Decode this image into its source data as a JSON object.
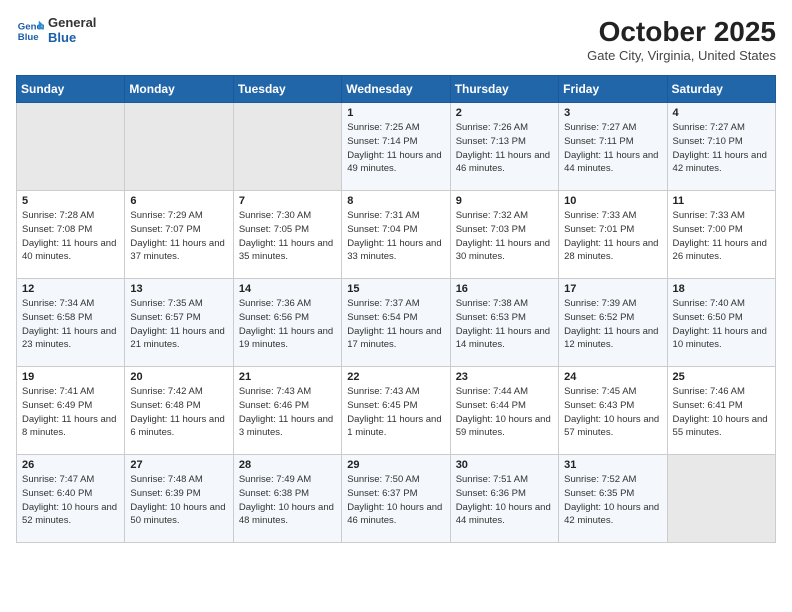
{
  "header": {
    "logo_line1": "General",
    "logo_line2": "Blue",
    "month": "October 2025",
    "location": "Gate City, Virginia, United States"
  },
  "days_of_week": [
    "Sunday",
    "Monday",
    "Tuesday",
    "Wednesday",
    "Thursday",
    "Friday",
    "Saturday"
  ],
  "weeks": [
    [
      {
        "day": "",
        "empty": true
      },
      {
        "day": "",
        "empty": true
      },
      {
        "day": "",
        "empty": true
      },
      {
        "day": "1",
        "rise": "7:25 AM",
        "set": "7:14 PM",
        "daylight": "11 hours and 49 minutes."
      },
      {
        "day": "2",
        "rise": "7:26 AM",
        "set": "7:13 PM",
        "daylight": "11 hours and 46 minutes."
      },
      {
        "day": "3",
        "rise": "7:27 AM",
        "set": "7:11 PM",
        "daylight": "11 hours and 44 minutes."
      },
      {
        "day": "4",
        "rise": "7:27 AM",
        "set": "7:10 PM",
        "daylight": "11 hours and 42 minutes."
      }
    ],
    [
      {
        "day": "5",
        "rise": "7:28 AM",
        "set": "7:08 PM",
        "daylight": "11 hours and 40 minutes."
      },
      {
        "day": "6",
        "rise": "7:29 AM",
        "set": "7:07 PM",
        "daylight": "11 hours and 37 minutes."
      },
      {
        "day": "7",
        "rise": "7:30 AM",
        "set": "7:05 PM",
        "daylight": "11 hours and 35 minutes."
      },
      {
        "day": "8",
        "rise": "7:31 AM",
        "set": "7:04 PM",
        "daylight": "11 hours and 33 minutes."
      },
      {
        "day": "9",
        "rise": "7:32 AM",
        "set": "7:03 PM",
        "daylight": "11 hours and 30 minutes."
      },
      {
        "day": "10",
        "rise": "7:33 AM",
        "set": "7:01 PM",
        "daylight": "11 hours and 28 minutes."
      },
      {
        "day": "11",
        "rise": "7:33 AM",
        "set": "7:00 PM",
        "daylight": "11 hours and 26 minutes."
      }
    ],
    [
      {
        "day": "12",
        "rise": "7:34 AM",
        "set": "6:58 PM",
        "daylight": "11 hours and 23 minutes."
      },
      {
        "day": "13",
        "rise": "7:35 AM",
        "set": "6:57 PM",
        "daylight": "11 hours and 21 minutes."
      },
      {
        "day": "14",
        "rise": "7:36 AM",
        "set": "6:56 PM",
        "daylight": "11 hours and 19 minutes."
      },
      {
        "day": "15",
        "rise": "7:37 AM",
        "set": "6:54 PM",
        "daylight": "11 hours and 17 minutes."
      },
      {
        "day": "16",
        "rise": "7:38 AM",
        "set": "6:53 PM",
        "daylight": "11 hours and 14 minutes."
      },
      {
        "day": "17",
        "rise": "7:39 AM",
        "set": "6:52 PM",
        "daylight": "11 hours and 12 minutes."
      },
      {
        "day": "18",
        "rise": "7:40 AM",
        "set": "6:50 PM",
        "daylight": "11 hours and 10 minutes."
      }
    ],
    [
      {
        "day": "19",
        "rise": "7:41 AM",
        "set": "6:49 PM",
        "daylight": "11 hours and 8 minutes."
      },
      {
        "day": "20",
        "rise": "7:42 AM",
        "set": "6:48 PM",
        "daylight": "11 hours and 6 minutes."
      },
      {
        "day": "21",
        "rise": "7:43 AM",
        "set": "6:46 PM",
        "daylight": "11 hours and 3 minutes."
      },
      {
        "day": "22",
        "rise": "7:43 AM",
        "set": "6:45 PM",
        "daylight": "11 hours and 1 minute."
      },
      {
        "day": "23",
        "rise": "7:44 AM",
        "set": "6:44 PM",
        "daylight": "10 hours and 59 minutes."
      },
      {
        "day": "24",
        "rise": "7:45 AM",
        "set": "6:43 PM",
        "daylight": "10 hours and 57 minutes."
      },
      {
        "day": "25",
        "rise": "7:46 AM",
        "set": "6:41 PM",
        "daylight": "10 hours and 55 minutes."
      }
    ],
    [
      {
        "day": "26",
        "rise": "7:47 AM",
        "set": "6:40 PM",
        "daylight": "10 hours and 52 minutes."
      },
      {
        "day": "27",
        "rise": "7:48 AM",
        "set": "6:39 PM",
        "daylight": "10 hours and 50 minutes."
      },
      {
        "day": "28",
        "rise": "7:49 AM",
        "set": "6:38 PM",
        "daylight": "10 hours and 48 minutes."
      },
      {
        "day": "29",
        "rise": "7:50 AM",
        "set": "6:37 PM",
        "daylight": "10 hours and 46 minutes."
      },
      {
        "day": "30",
        "rise": "7:51 AM",
        "set": "6:36 PM",
        "daylight": "10 hours and 44 minutes."
      },
      {
        "day": "31",
        "rise": "7:52 AM",
        "set": "6:35 PM",
        "daylight": "10 hours and 42 minutes."
      },
      {
        "day": "",
        "empty": true
      }
    ]
  ],
  "labels": {
    "sunrise": "Sunrise:",
    "sunset": "Sunset:",
    "daylight": "Daylight:"
  }
}
